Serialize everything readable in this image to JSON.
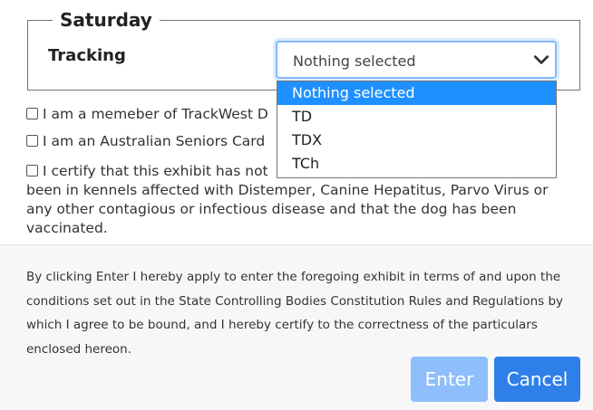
{
  "section": {
    "legend": "Saturday",
    "field_label": "Tracking",
    "select_value": "Nothing selected",
    "options": [
      "Nothing selected",
      "TD",
      "TDX",
      "TCh"
    ]
  },
  "checkboxes": [
    "I am a memeber of TrackWest D",
    "I am an Australian Seniors Card"
  ],
  "certify": {
    "line1": "I certify that this exhibit has not",
    "rest": "been in kennels affected with Distemper, Canine Hepatitus, Parvo Virus or any other contagious or infectious disease and that the dog has been vaccinated."
  },
  "footer": {
    "text": "By clicking Enter I hereby apply to enter the foregoing exhibit in terms of and upon the conditions set out in the State Controlling Bodies Constitution Rules and Regulations by which I agree to be bound, and I hereby certify to the correctness of the particulars enclosed hereon.",
    "enter_label": "Enter",
    "cancel_label": "Cancel"
  },
  "colors": {
    "selected_option": "#1e90ff",
    "enter_button": "#8ebefc",
    "cancel_button": "#2f7fe8"
  }
}
